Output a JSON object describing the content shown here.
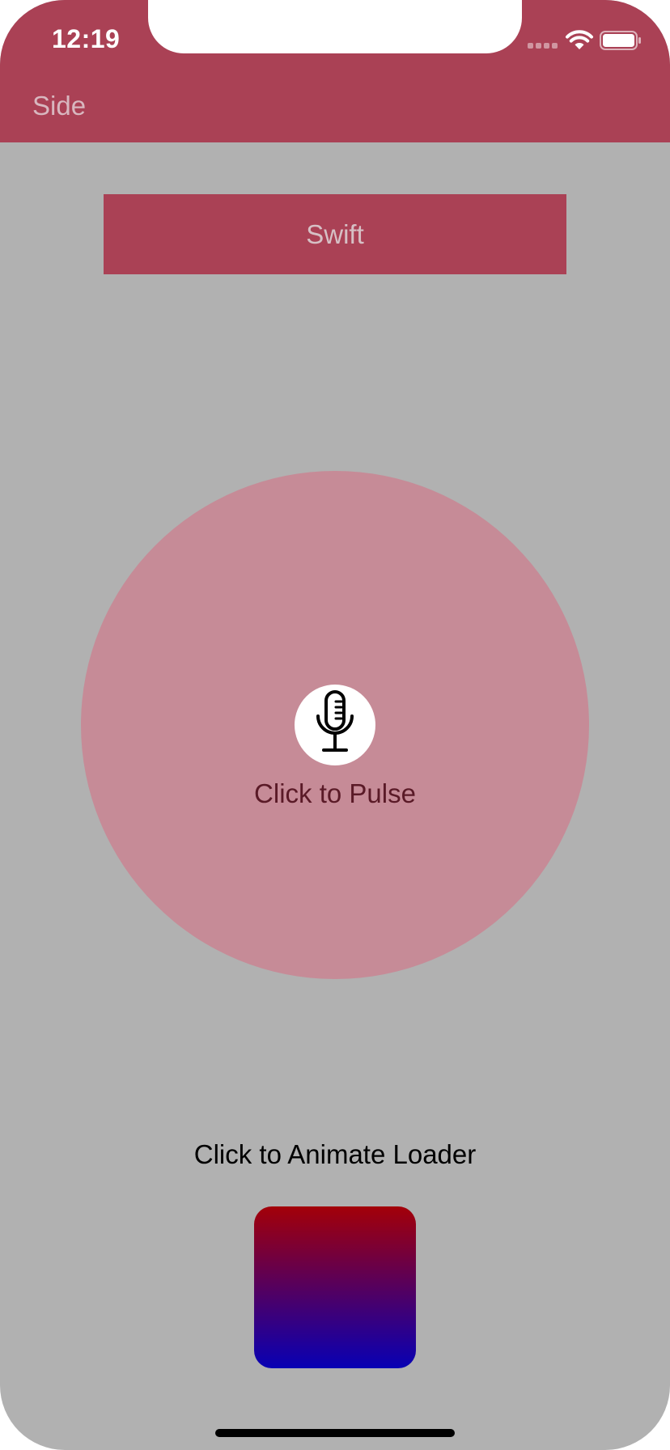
{
  "status_bar": {
    "time": "12:19"
  },
  "nav": {
    "side_label": "Side"
  },
  "buttons": {
    "swift_label": "Swift"
  },
  "pulse": {
    "label": "Click to Pulse",
    "icon": "microphone-icon"
  },
  "loader": {
    "label": "Click to Animate Loader",
    "gradient_top": "#a30008",
    "gradient_bottom": "#0800b4"
  },
  "colors": {
    "accent": "#aa4155",
    "background": "#b1b1b1",
    "pulse_circle": "#c68b97"
  }
}
